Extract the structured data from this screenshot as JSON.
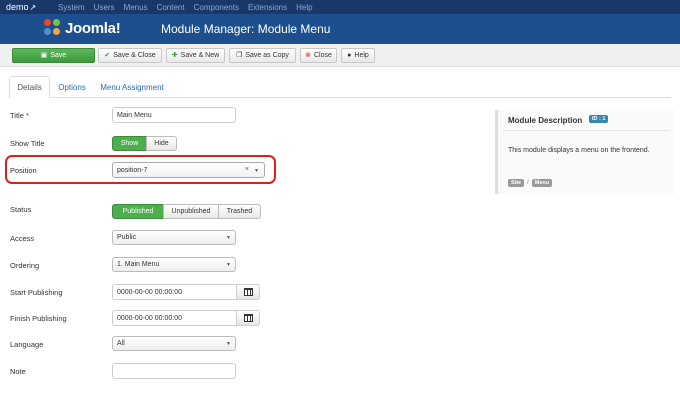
{
  "topnav": {
    "brand": "demo",
    "external_icon": "external-link-icon",
    "menu": [
      "System",
      "Users",
      "Menus",
      "Content",
      "Components",
      "Extensions",
      "Help"
    ]
  },
  "header": {
    "logo_text": "Joomla!",
    "title": "Module Manager: Module Menu"
  },
  "toolbar": {
    "save": "Save",
    "save_close": "Save & Close",
    "save_new": "Save & New",
    "save_copy": "Save as Copy",
    "close": "Close",
    "help": "Help",
    "icons": {
      "save": "save-icon",
      "save_close": "check-icon",
      "save_new": "plus-icon",
      "save_copy": "copy-icon",
      "close": "cancel-icon",
      "help": "help-icon"
    }
  },
  "tabs": [
    "Details",
    "Options",
    "Menu Assignment"
  ],
  "form": {
    "title": {
      "label": "Title *",
      "value": "Main Menu"
    },
    "show_title": {
      "label": "Show Title",
      "options": [
        "Show",
        "Hide"
      ],
      "selected": "Show"
    },
    "position": {
      "label": "Position",
      "value": "position-7",
      "clear": "×"
    },
    "status": {
      "label": "Status",
      "options": [
        "Published",
        "Unpublished",
        "Trashed"
      ],
      "selected": "Published"
    },
    "access": {
      "label": "Access",
      "value": "Public"
    },
    "ordering": {
      "label": "Ordering",
      "value": "1. Main Menu"
    },
    "start_publishing": {
      "label": "Start Publishing",
      "value": "0000-00-00 00:00:00"
    },
    "finish_publishing": {
      "label": "Finish Publishing",
      "value": "0000-00-00 00:00:00"
    },
    "language": {
      "label": "Language",
      "value": "All"
    },
    "note": {
      "label": "Note",
      "value": ""
    }
  },
  "sidebar": {
    "title": "Module Description",
    "id_badge": "ID : 1",
    "description": "This module displays a menu on the frontend.",
    "tags": [
      "Site",
      "Menu"
    ],
    "separator": "/"
  },
  "colors": {
    "topnav_bg": "#1a3867",
    "header_bg": "#1d4f8e",
    "primary_green": "#4cae4c",
    "link_blue": "#2a69b8",
    "highlight_red": "#e01e1e",
    "badge_blue": "#3a87ad"
  }
}
